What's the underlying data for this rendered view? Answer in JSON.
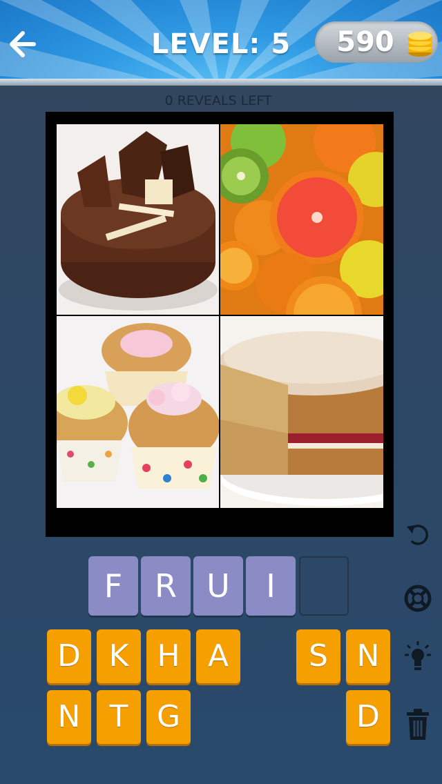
{
  "header": {
    "level_text": "LEVEL: 5",
    "coins": "590",
    "back_icon": "back-arrow-icon"
  },
  "reveals_text": "0 REVEALS LEFT",
  "photos": [
    {
      "subject": "chocolate cake"
    },
    {
      "subject": "citrus fruits"
    },
    {
      "subject": "cupcakes"
    },
    {
      "subject": "sponge cake"
    }
  ],
  "answer": {
    "slots": [
      "F",
      "R",
      "U",
      "I",
      ""
    ]
  },
  "letters": {
    "row1": [
      "D",
      "K",
      "H",
      "A",
      "",
      "S",
      "N"
    ],
    "row2": [
      "N",
      "T",
      "G",
      "",
      "",
      "",
      "D"
    ]
  },
  "side_icons": [
    "undo-icon",
    "lifebuoy-icon",
    "lightbulb-icon",
    "trash-icon"
  ],
  "colors": {
    "header_blue": "#2f9ae4",
    "answer_tile": "#8b8bc6",
    "letter_tile": "#f5a000",
    "background": "#2c4663"
  }
}
